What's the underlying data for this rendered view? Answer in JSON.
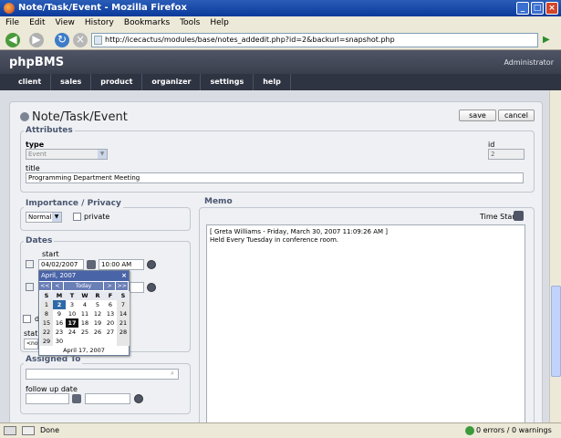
{
  "window": {
    "title": "Note/Task/Event - Mozilla Firefox"
  },
  "menu": [
    "File",
    "Edit",
    "View",
    "History",
    "Bookmarks",
    "Tools",
    "Help"
  ],
  "browser": {
    "url": "http://icecactus/modules/base/notes_addedit.php?id=2&backurl=snapshot.php"
  },
  "app": {
    "brand": "phpBMS",
    "user": "Administrator",
    "nav": [
      "client",
      "sales",
      "product",
      "organizer",
      "settings",
      "help"
    ]
  },
  "page": {
    "title": "Note/Task/Event",
    "save_label": "save",
    "cancel_label": "cancel"
  },
  "attributes": {
    "legend": "Attributes",
    "type_label": "type",
    "type_value": "Event",
    "id_label": "id",
    "id_value": "2",
    "title_label": "title",
    "title_value": "Programming Department Meeting"
  },
  "importance": {
    "legend": "Importance / Privacy",
    "value": "Normal",
    "private_label": "private"
  },
  "dates": {
    "legend": "Dates",
    "start_label": "start",
    "start_date": "04/02/2007",
    "start_time": "10:00 AM",
    "d_label": "d",
    "status_label": "statu",
    "status_value": "<nor"
  },
  "calendar": {
    "month": "April, 2007",
    "close": "×",
    "nav": [
      "<<",
      "<",
      "Today",
      ">",
      ">>"
    ],
    "weekdays": [
      "S",
      "M",
      "T",
      "W",
      "R",
      "F",
      "S"
    ],
    "weeks": [
      [
        "1",
        "2",
        "3",
        "4",
        "5",
        "6",
        "7"
      ],
      [
        "8",
        "9",
        "10",
        "11",
        "12",
        "13",
        "14"
      ],
      [
        "15",
        "16",
        "17",
        "18",
        "19",
        "20",
        "21"
      ],
      [
        "22",
        "23",
        "24",
        "25",
        "26",
        "27",
        "28"
      ],
      [
        "29",
        "30",
        "",
        "",
        "",
        "",
        ""
      ]
    ],
    "footer": "April 17, 2007"
  },
  "assigned": {
    "legend": "Assigned To",
    "follow_up_label": "follow up date"
  },
  "memo": {
    "legend": "Memo",
    "timestamp_label": "Time Stamp",
    "line1": "[ Greta Williams - Friday, March 30, 2007 11:09:26 AM ]",
    "line2": "Held Every Tuesday in conference room."
  },
  "status": {
    "text": "Done",
    "errors": "0 errors / 0 warnings"
  }
}
